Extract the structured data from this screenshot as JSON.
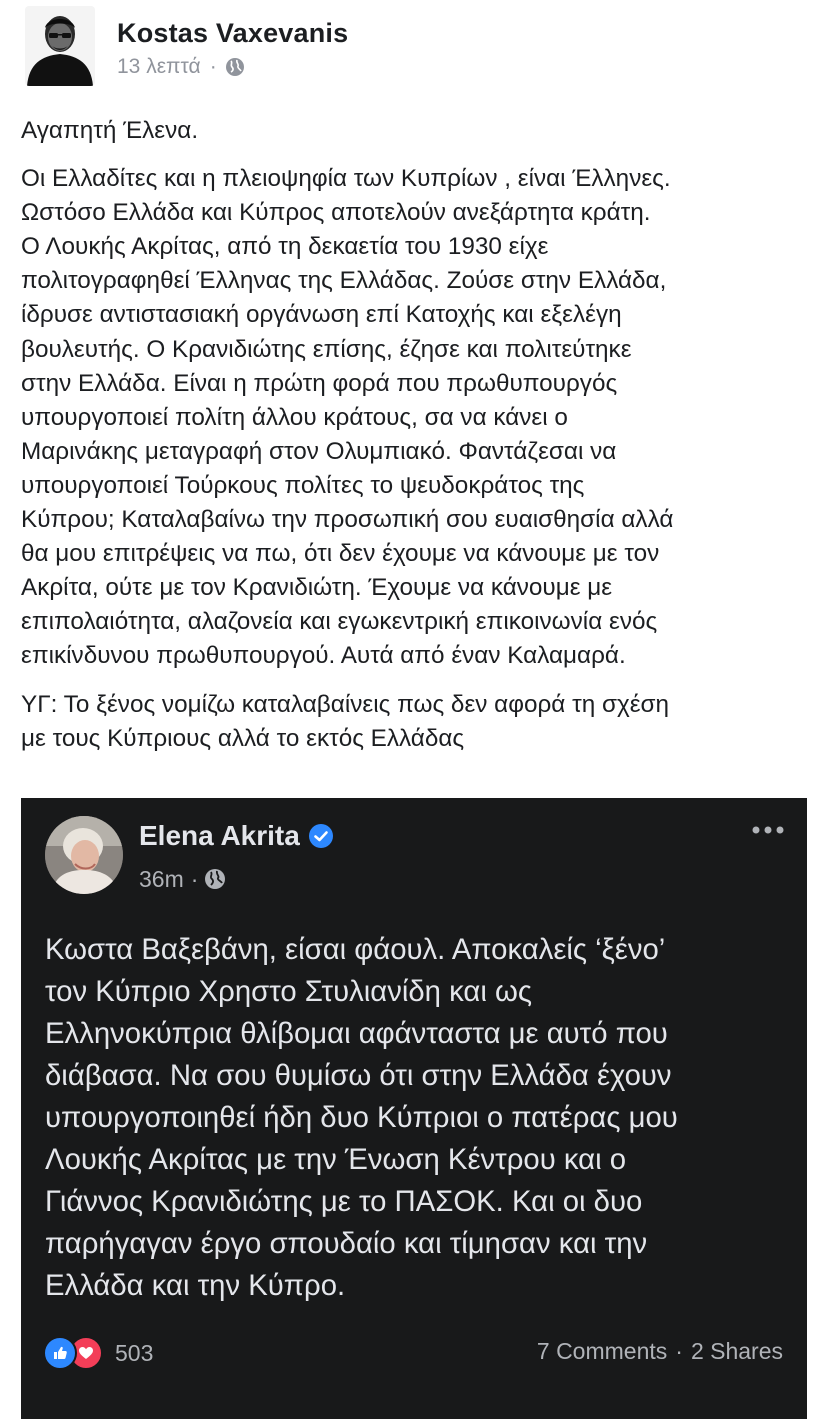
{
  "post": {
    "author_name": "Kostas Vaxevanis",
    "time": "13 λεπτά",
    "separator": "·",
    "privacy_icon": "globe-icon",
    "paragraphs": [
      "Αγαπητή Έλενα.",
      "Οι Ελλαδίτες και η πλειοψηφία των Κυπρίων , είναι Έλληνες.\nΩστόσο Ελλάδα και Κύπρος αποτελούν ανεξάρτητα κράτη.\nΟ Λουκής Ακρίτας, από τη δεκαετία του 1930 είχε\nπολιτογραφηθεί Έλληνας της Ελλάδας. Ζούσε στην Ελλάδα,\nίδρυσε αντιστασιακή οργάνωση επί Κατοχής και εξελέγη\nβουλευτής. Ο Κρανιδιώτης επίσης, έζησε και πολιτεύτηκε\nστην Ελλάδα. Είναι η πρώτη φορά που πρωθυπουργός\nυπουργοποιεί πολίτη άλλου κράτους, σα να κάνει ο\nΜαρινάκης μεταγραφή στον Ολυμπιακό. Φαντάζεσαι να\nυπουργοποιεί Τούρκους πολίτες το ψευδοκράτος της\nΚύπρου; Καταλαβαίνω την προσωπική σου ευαισθησία αλλά\nθα μου επιτρέψεις να πω, ότι δεν έχουμε να κάνουμε με τον\nΑκρίτα, ούτε με τον Κρανιδιώτη. Έχουμε να κάνουμε με\nεπιπολαιότητα, αλαζονεία και εγωκεντρική επικοινωνία ενός\nεπικίνδυνου πρωθυπουργού. Αυτά από έναν Καλαμαρά.",
      "ΥΓ: Το ξένος νομίζω καταλαβαίνεις πως δεν αφορά τη σχέση\nμε τους Κύπριους αλλά το εκτός Ελλάδας"
    ]
  },
  "embed": {
    "author_name": "Elena Akrita",
    "verified_icon": "verified-badge-icon",
    "time": "36m",
    "separator": "·",
    "privacy_icon": "globe-icon",
    "more_icon": "more-options-icon",
    "text": "Κωστα Βαξεβάνη, είσαι φάουλ. Αποκαλείς ‘ξένο’\nτον Κύπριο Χρηστο Στυλιανίδη και ως\nΕλληνοκύπρια θλίβομαι αφάνταστα με αυτό που\nδιάβασα. Να σου θυμίσω ότι στην Ελλάδα έχουν\nυπουργοποιηθεί ήδη δυο Κύπριοι ο πατέρας μου\nΛουκής Ακρίτας με την Ένωση Κέντρου και ο\nΓιάννος Κρανιδιώτης με το ΠΑΣΟΚ. Και οι δυο\nπαρήγαγαν έργο σπουδαίο και τίμησαν και την\nΕλλάδα και την Κύπρο.",
    "reaction_count": "503",
    "comments": "7 Comments",
    "shares": "2 Shares",
    "separator2": "·",
    "colors": {
      "background": "#18191a",
      "like": "#2d88ff",
      "love": "#f33e58",
      "verified": "#2d88ff"
    }
  }
}
